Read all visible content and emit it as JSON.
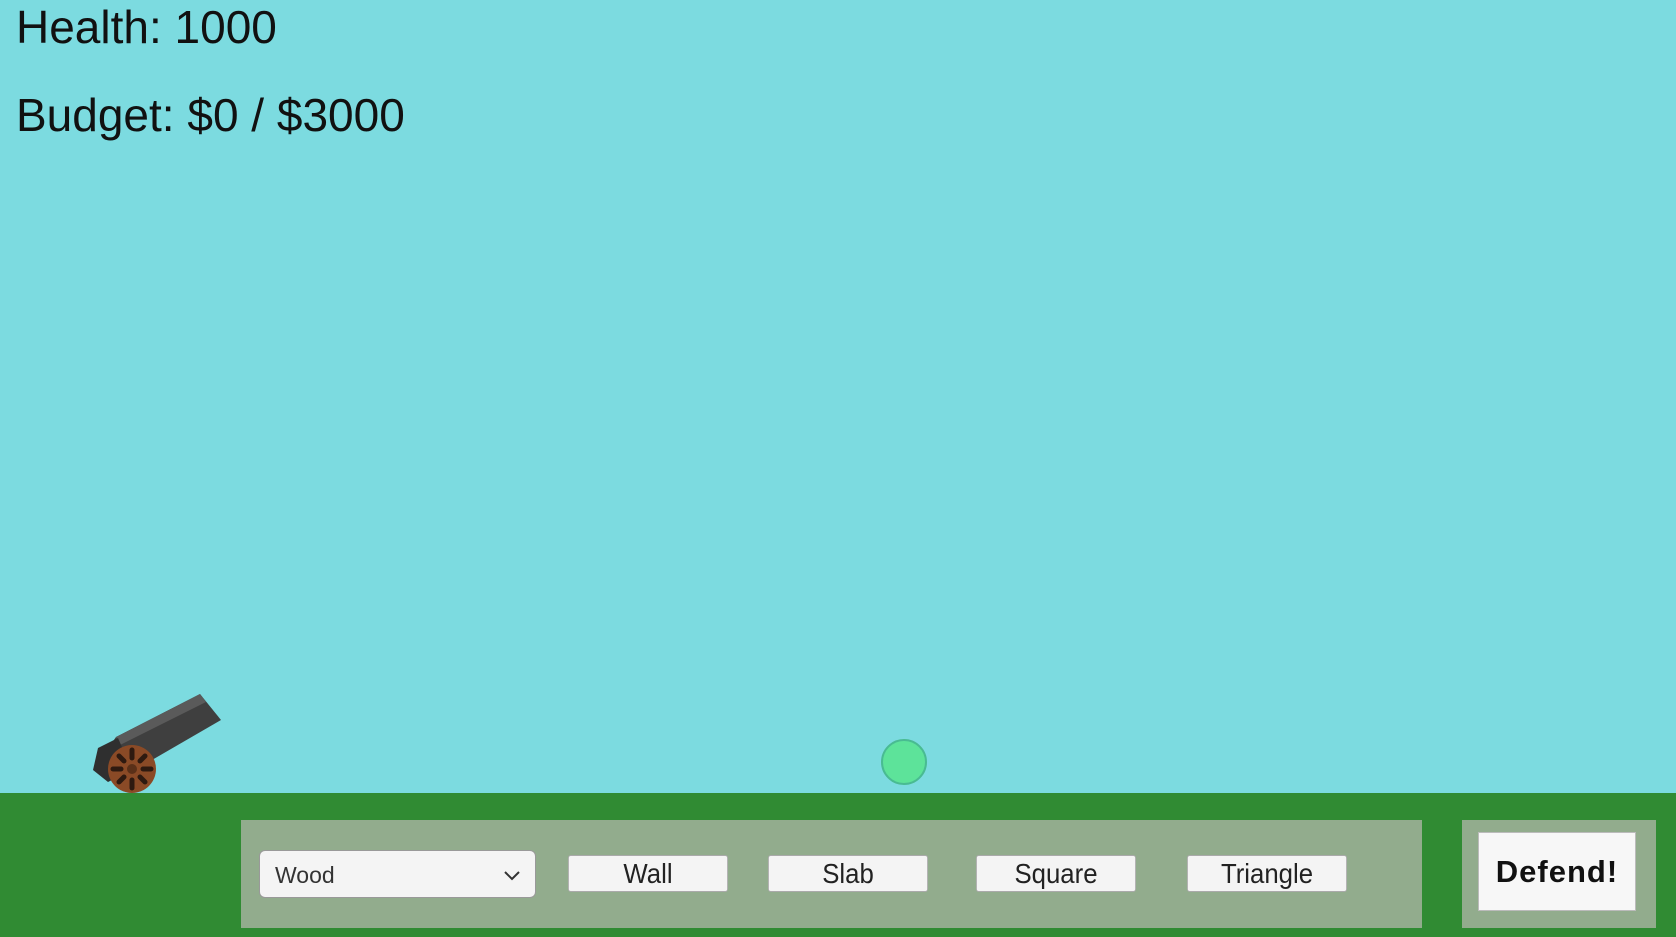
{
  "hud": {
    "health_text": "Health: 1000",
    "budget_text": "Budget: $0 / $3000"
  },
  "build_panel": {
    "material_selected": "Wood",
    "shape_buttons": [
      "Wall",
      "Slab",
      "Square",
      "Triangle"
    ]
  },
  "defend_button": "Defend!",
  "icons": {
    "cannon": "cannon-icon",
    "dropdown": "chevron-down-icon"
  },
  "colors": {
    "sky": "#7cdbe0",
    "ground": "#308b33",
    "panel": "#92ac8d",
    "target_ball": "#5de39a"
  }
}
